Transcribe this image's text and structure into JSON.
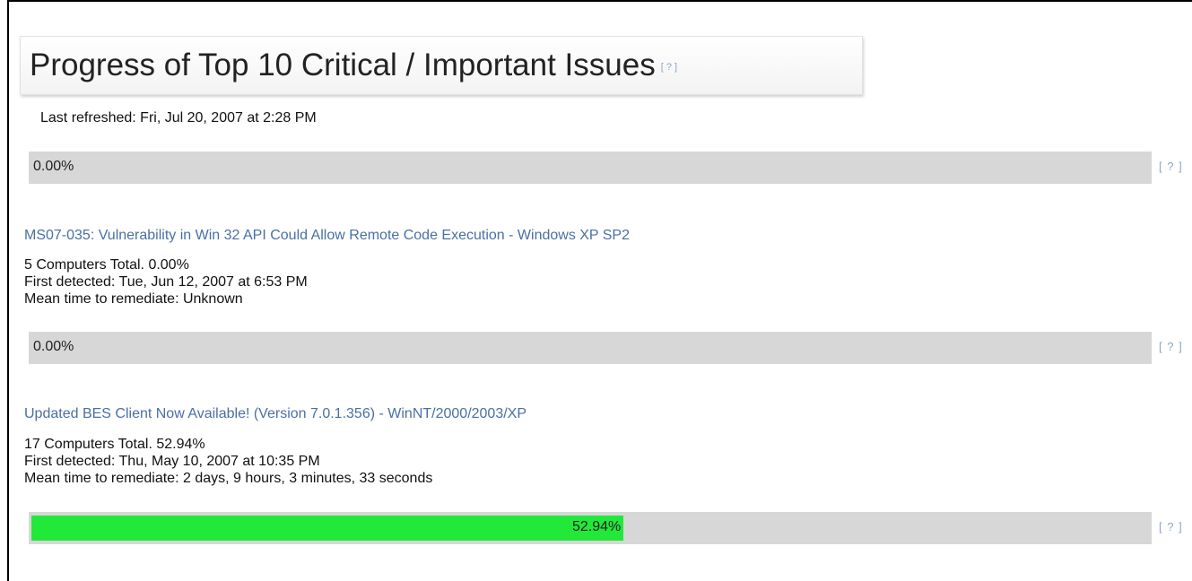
{
  "header": {
    "title": "Progress of Top 10 Critical / Important Issues",
    "help_label": "[ ? ]",
    "last_refreshed": "Last refreshed: Fri, Jul 20, 2007 at 2:28 PM"
  },
  "overall": {
    "percent_label": "0.00%",
    "progress_fraction": 0.0,
    "help_label": "[ ? ]"
  },
  "issues": [
    {
      "title": "MS07-035: Vulnerability in Win 32 API Could Allow Remote Code Execution - Windows XP SP2",
      "total_line": "5 Computers Total.   0.00%",
      "first_detected": "First detected: Tue, Jun 12, 2007 at 6:53 PM",
      "mean_time": "Mean time to remediate: Unknown",
      "percent_label": "0.00%",
      "progress_fraction": 0.0,
      "help_label": "[ ? ]"
    },
    {
      "title": "Updated BES Client Now Available! (Version 7.0.1.356) - WinNT/2000/2003/XP",
      "total_line": "17 Computers Total.   52.94%",
      "first_detected": "First detected: Thu, May 10, 2007 at 10:35 PM",
      "mean_time": "Mean time to remediate: 2 days, 9 hours, 3 minutes, 33 seconds",
      "percent_label": "52.94%",
      "progress_fraction": 0.5294,
      "help_label": "[ ? ]"
    }
  ],
  "colors": {
    "progress_fill": "#22e83a",
    "progress_track": "#d7d7d7",
    "link": "#4a6fa5"
  }
}
